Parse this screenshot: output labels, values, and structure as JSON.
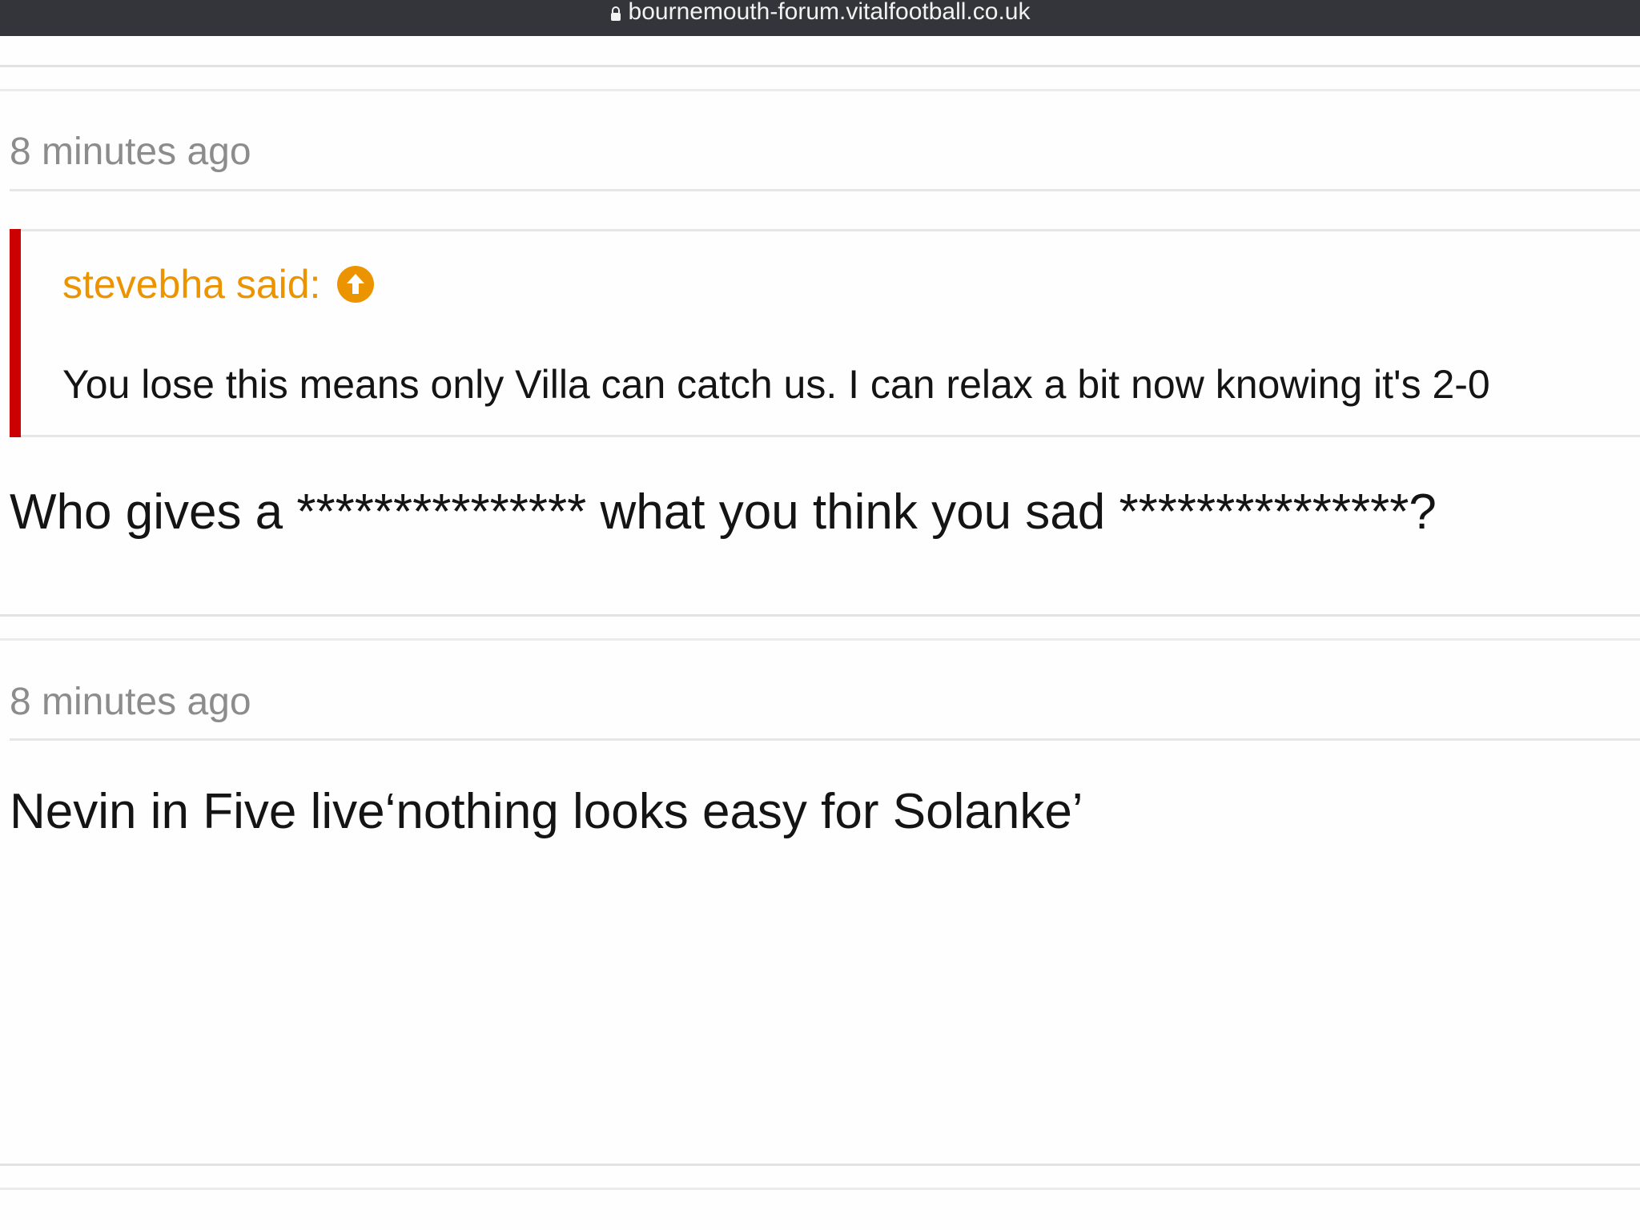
{
  "browser": {
    "url": "bournemouth-forum.vitalfootball.co.uk",
    "lock_icon": "lock-icon"
  },
  "posts": [
    {
      "timestamp": "8 minutes ago",
      "quote": {
        "author": "stevebha said:",
        "jump_icon": "arrow-up-circle-icon",
        "text": "You lose this means only Villa can catch us. I can relax a bit now knowing it's 2-0"
      },
      "body": "Who gives a *************** what you think you sad ***************?"
    },
    {
      "timestamp": "8 minutes ago",
      "body": "Nevin in Five live‘nothing looks easy for Solanke’"
    }
  ],
  "colors": {
    "url_bar": "#34353a",
    "quote_author": "#ec9400",
    "quote_border": "#cc0000",
    "timestamp": "#8c8c8c",
    "text": "#141414"
  }
}
